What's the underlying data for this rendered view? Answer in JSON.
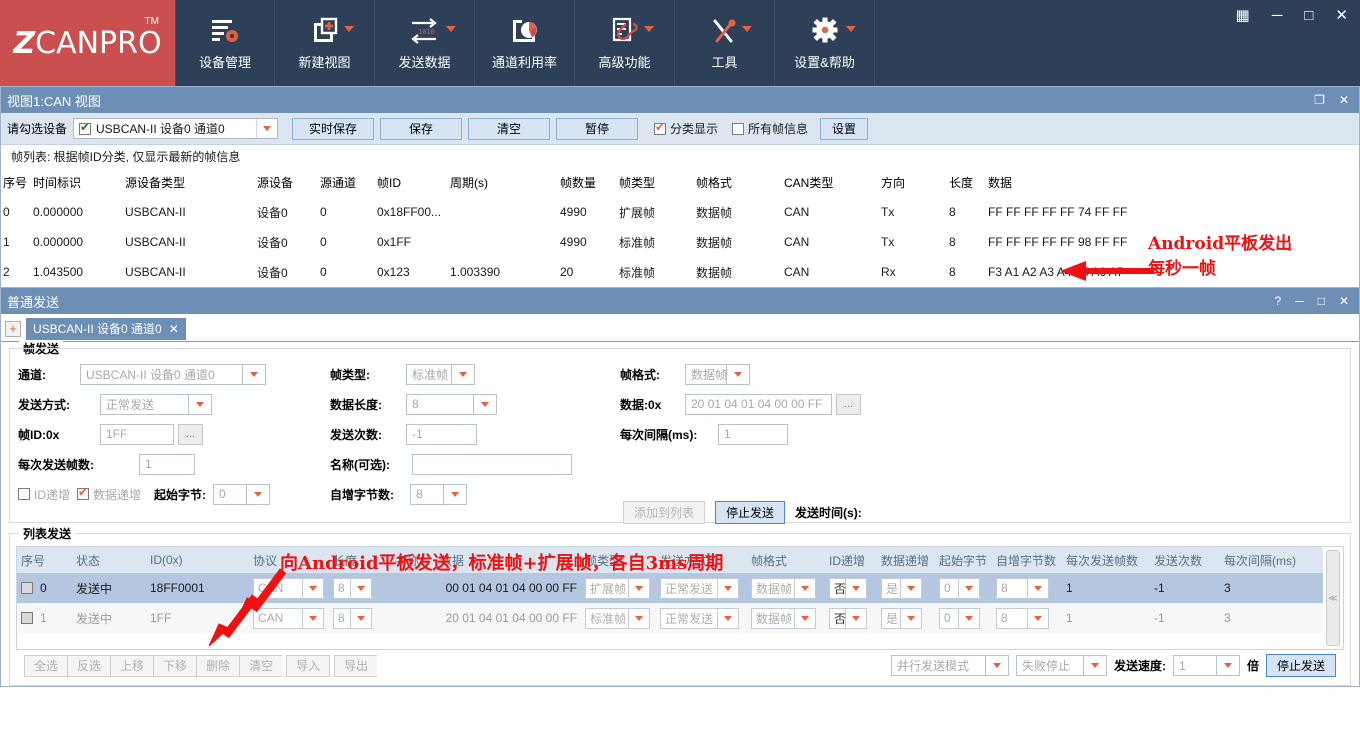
{
  "app": {
    "brand_z": "Z",
    "brand_rest": "CANPRO",
    "tm": "TM"
  },
  "ribbon": {
    "items": [
      {
        "label": "设备管理",
        "icon": "device-gear-icon",
        "caret": false
      },
      {
        "label": "新建视图",
        "icon": "new-view-plus-icon",
        "caret": true
      },
      {
        "label": "发送数据",
        "icon": "send-data-arrows-icon",
        "caret": true
      },
      {
        "label": "通道利用率",
        "icon": "channel-usage-pie-icon",
        "caret": false
      },
      {
        "label": "高级功能",
        "icon": "advanced-clip-icon",
        "caret": true
      },
      {
        "label": "工具",
        "icon": "tools-hammer-wrench-icon",
        "caret": true
      },
      {
        "label": "设置&帮助",
        "icon": "settings-gear-icon",
        "caret": true
      }
    ],
    "window_controls": {
      "grid": "▦",
      "minimize": "─",
      "maximize": "□",
      "close": "✕"
    }
  },
  "view_panel": {
    "title": "视图1:CAN 视图",
    "title_restore": "❐",
    "title_close": "✕",
    "toolbar": {
      "device_label": "请勾选设备",
      "device_value": "USBCAN-II 设备0 通道0",
      "buttons": [
        "实时保存",
        "保存",
        "清空",
        "暂停"
      ],
      "classify_label": "分类显示",
      "classify_checked": true,
      "allframes_label": "所有帧信息",
      "allframes_checked": false,
      "settings_label": "设置"
    },
    "hint": "帧列表: 根据帧ID分类, 仅显示最新的帧信息",
    "table": {
      "columns": [
        "序号",
        "时间标识",
        "源设备类型",
        "源设备",
        "源通道",
        "帧ID",
        "周期(s)",
        "帧数量",
        "帧类型",
        "帧格式",
        "CAN类型",
        "方向",
        "长度",
        "数据"
      ],
      "rows": [
        [
          "0",
          "0.000000",
          "USBCAN-II",
          "设备0",
          "0",
          "0x18FF00...",
          "",
          "4990",
          "扩展帧",
          "数据帧",
          "CAN",
          "Tx",
          "8",
          "FF FF FF FF FF 74 FF FF"
        ],
        [
          "1",
          "0.000000",
          "USBCAN-II",
          "设备0",
          "0",
          "0x1FF",
          "",
          "4990",
          "标准帧",
          "数据帧",
          "CAN",
          "Tx",
          "8",
          "FF FF FF FF FF 98 FF FF"
        ],
        [
          "2",
          "1.043500",
          "USBCAN-II",
          "设备0",
          "0",
          "0x123",
          "1.003390",
          "20",
          "标准帧",
          "数据帧",
          "CAN",
          "Rx",
          "8",
          "F3 A1 A2 A3 A4 A5 A6 A7"
        ]
      ]
    },
    "annotation_rx": {
      "line1": "Android平板发出",
      "line2": "每秒一帧",
      "color": "#ee1111"
    }
  },
  "send_panel": {
    "title": "普通发送",
    "title_controls": {
      "help": "?",
      "minimize": "─",
      "maximize": "□",
      "close": "✕"
    },
    "tab_add": "+",
    "tab_label": "USBCAN-II 设备0 通道0",
    "tab_close": "✕",
    "frame_send": {
      "group_title": "帧发送",
      "channel_label": "通道:",
      "channel_value": "USBCAN-II 设备0 通道0",
      "send_mode_label": "发送方式:",
      "send_mode_value": "正常发送",
      "frame_id_label": "帧ID:0x",
      "frame_id_value": "1FF",
      "frame_id_ellipsis": "...",
      "frames_each_label": "每次发送帧数:",
      "frames_each_value": "1",
      "id_inc_label": "ID递增",
      "id_inc_checked": false,
      "data_inc_label": "数据递增",
      "data_inc_checked": true,
      "start_byte_label": "起始字节:",
      "start_byte_value": "0",
      "frame_type_label": "帧类型:",
      "frame_type_value": "标准帧",
      "data_len_label": "数据长度:",
      "data_len_value": "8",
      "send_times_label": "发送次数:",
      "send_times_value": "-1",
      "name_label": "名称(可选):",
      "name_value": "",
      "auto_inc_bytes_label": "自增字节数:",
      "auto_inc_bytes_value": "8",
      "frame_format_label": "帧格式:",
      "frame_format_value": "数据帧",
      "data_label": "数据:0x",
      "data_value": "20 01 04 01 04 00 00 FF",
      "data_ellipsis": "...",
      "interval_label": "每次间隔(ms):",
      "interval_value": "1",
      "add_to_list_label": "添加到列表",
      "stop_send_label": "停止发送",
      "send_time_label": "发送时间(s):"
    },
    "list_send": {
      "group_title": "列表发送",
      "annotation": "向Android平板发送，标准帧+扩展帧，各自3ms周期",
      "annotation_color": "#ee1111",
      "columns": [
        "序号",
        "状态",
        "ID(0x)",
        "协议",
        "长度",
        "名称",
        "数据",
        "帧类型",
        "发送方式",
        "帧格式",
        "ID递增",
        "数据递增",
        "起始字节",
        "自增字节数",
        "每次发送帧数",
        "发送次数",
        "每次间隔(ms)"
      ],
      "rows": [
        {
          "checked": true,
          "selected": true,
          "seq": "0",
          "status": "发送中",
          "id": "18FF0001",
          "protocol": "CAN",
          "length": "8",
          "name": "",
          "data": "00 01 04 01 04 00 00 FF",
          "frame_type": "扩展帧",
          "send_mode": "正常发送",
          "frame_format": "数据帧",
          "id_inc": "否",
          "data_inc": "是",
          "start_byte": "0",
          "auto_inc_bytes": "8",
          "frames_each": "1",
          "send_times": "-1",
          "interval": "3"
        },
        {
          "checked": true,
          "selected": false,
          "seq": "1",
          "status": "发送中",
          "id": "1FF",
          "protocol": "CAN",
          "length": "8",
          "name": "",
          "data": "20 01 04 01 04 00 00 FF",
          "frame_type": "标准帧",
          "send_mode": "正常发送",
          "frame_format": "数据帧",
          "id_inc": "否",
          "data_inc": "是",
          "start_byte": "0",
          "auto_inc_bytes": "8",
          "frames_each": "1",
          "send_times": "-1",
          "interval": "3"
        }
      ],
      "scroll_mark": "≪",
      "toolbar_buttons": [
        "全选",
        "反选",
        "上移",
        "下移",
        "删除",
        "清空",
        "导入",
        "导出"
      ],
      "parallel_mode_value": "并行发送模式",
      "fail_stop_value": "失败停止",
      "speed_label": "发送速度:",
      "speed_value": "1",
      "speed_unit": "倍",
      "stop_send_label": "停止发送"
    }
  }
}
